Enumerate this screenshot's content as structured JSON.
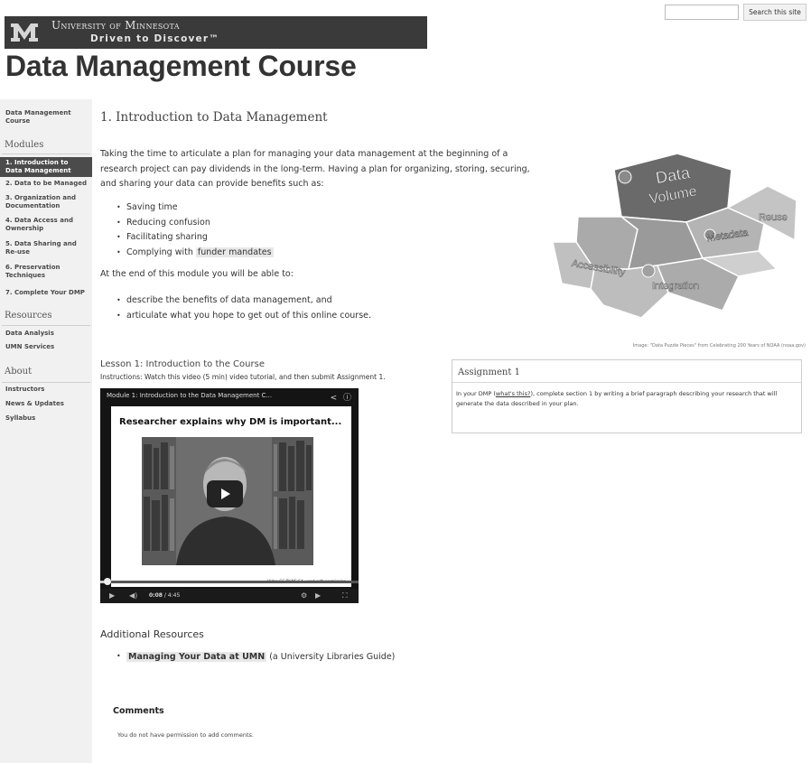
{
  "header": {
    "university": "University of Minnesota",
    "tagline": "Driven to Discover™",
    "search_placeholder": "",
    "search_button": "Search this site"
  },
  "page_title": "Data Management Course",
  "sidebar": {
    "top_link": "Data Management Course",
    "modules_heading": "Modules",
    "modules": [
      "1. Introduction to Data Management",
      "2. Data to be Managed",
      "3. Organization and Documentation",
      "4. Data Access and Ownership",
      "5. Data Sharing and Re-use",
      "6. Preservation Techniques",
      "7. Complete Your DMP"
    ],
    "resources_heading": "Resources",
    "resources": [
      "Data Analysis",
      "UMN Services"
    ],
    "about_heading": "About",
    "about": [
      "Instructors",
      "News & Updates",
      "Syllabus"
    ]
  },
  "main": {
    "module_title": "1. Introduction to Data Management",
    "intro": "Taking the time to articulate a plan for managing your data management at the beginning of a research project can pay dividends in the long-term. Having a plan for organizing, storing, securing, and sharing your data can provide benefits such as:",
    "benefits": [
      "Saving time",
      "Reducing confusion",
      "Facilitating sharing",
      "Complying with "
    ],
    "benefit_link": "funder mandates",
    "outcome_intro": "At the end of this module you will be able to:",
    "outcomes": [
      "describe the benefits of data management, and",
      "articulate what you hope to get out of this online course."
    ],
    "image_labels": [
      "Data Volume",
      "Reuse",
      "Metadata",
      "Accessibility",
      "Integration"
    ],
    "image_caption": "Image: \"Data Puzzle Pieces\" from Celebrating 200 Years of NOAA (noaa.gov)",
    "lesson_title": "Lesson 1: Introduction to the Course",
    "instructions": "Instructions: Watch this video (5 min) video tutorial, and then submit Assignment 1.",
    "video": {
      "title": "Module 1: Introduction to the Data Management C...",
      "slide_title": "Researcher explains why DM is important...",
      "slide_credit": "Video CC BY-NC-SA, used with permission",
      "time_current": "0:08",
      "time_total": "/ 4:45",
      "progress": 0.03
    },
    "assignment": {
      "title": "Assignment 1",
      "body_before": "In your DMP (",
      "link": "what's this?",
      "body_after": "), complete section 1 by writing a brief paragraph describing your research that will generate the data described in your plan."
    },
    "additional_title": "Additional Resources",
    "resource_link": "Managing Your Data at UMN",
    "resource_note": " (a University Libraries Guide)",
    "comments_title": "Comments",
    "comments_text": "You do not have permission to add comments."
  }
}
